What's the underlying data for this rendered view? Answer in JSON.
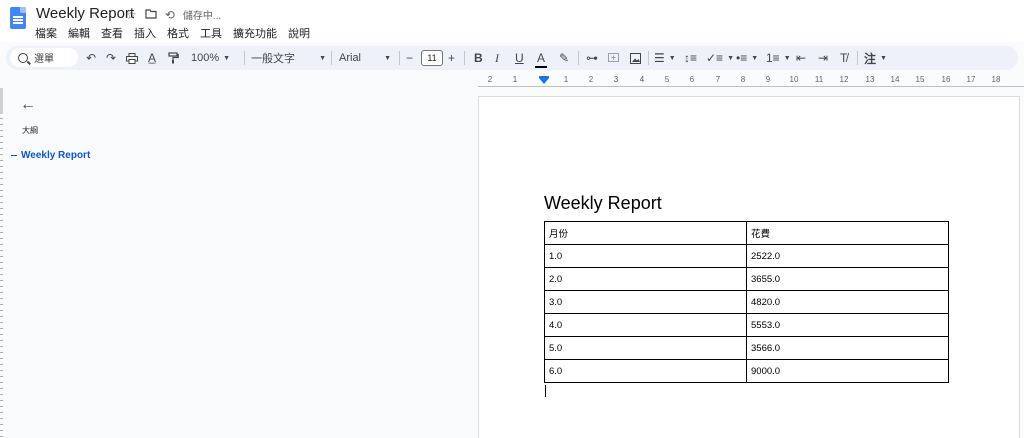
{
  "app": {
    "doc_title": "Weekly Report",
    "save_status": "儲存中..."
  },
  "menu": [
    "檔案",
    "編輯",
    "查看",
    "插入",
    "格式",
    "工具",
    "擴充功能",
    "說明"
  ],
  "toolbar": {
    "search_label": "選單",
    "zoom": "100%",
    "style": "一般文字",
    "font": "Arial",
    "font_size": "11",
    "input_tool": "注"
  },
  "ruler": {
    "numbers": [
      "2",
      "1",
      "1",
      "2",
      "3",
      "4",
      "5",
      "6",
      "7",
      "8",
      "9",
      "10",
      "11",
      "12",
      "13",
      "14",
      "15",
      "16",
      "17",
      "18"
    ]
  },
  "outline": {
    "label": "大綱",
    "items": [
      "Weekly Report"
    ]
  },
  "document": {
    "heading": "Weekly Report",
    "table": {
      "headers": [
        "月份",
        "花費"
      ],
      "rows": [
        [
          "1.0",
          "2522.0"
        ],
        [
          "2.0",
          "3655.0"
        ],
        [
          "3.0",
          "4820.0"
        ],
        [
          "4.0",
          "5553.0"
        ],
        [
          "5.0",
          "3566.0"
        ],
        [
          "6.0",
          "9000.0"
        ]
      ]
    }
  }
}
